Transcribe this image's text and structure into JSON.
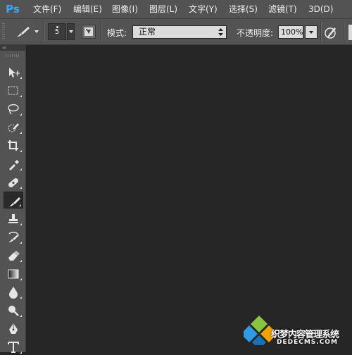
{
  "app": {
    "logo": "Ps"
  },
  "menu": {
    "items": [
      "文件(F)",
      "编辑(E)",
      "图像(I)",
      "图层(L)",
      "文字(Y)",
      "选择(S)",
      "滤镜(T)",
      "3D(D)"
    ]
  },
  "options": {
    "brush_size": "5",
    "mode_label": "模式:",
    "mode_value": "正常",
    "opacity_label": "不透明度:",
    "opacity_value": "100%"
  },
  "toolbox": {
    "collapse_label": "››",
    "tools": [
      {
        "name": "move-tool",
        "icon": "move-icon",
        "active": false
      },
      {
        "name": "rectangular-marquee-tool",
        "icon": "marquee-icon",
        "active": false
      },
      {
        "name": "lasso-tool",
        "icon": "lasso-icon",
        "active": false
      },
      {
        "name": "quick-selection-tool",
        "icon": "quick-selection-icon",
        "active": false
      },
      {
        "name": "crop-tool",
        "icon": "crop-icon",
        "active": false
      },
      {
        "name": "eyedropper-tool",
        "icon": "eyedropper-icon",
        "active": false
      },
      {
        "name": "spot-healing-brush-tool",
        "icon": "bandage-icon",
        "active": false
      },
      {
        "name": "brush-tool",
        "icon": "brush-icon",
        "active": true
      },
      {
        "name": "clone-stamp-tool",
        "icon": "stamp-icon",
        "active": false
      },
      {
        "name": "history-brush-tool",
        "icon": "history-brush-icon",
        "active": false
      },
      {
        "name": "eraser-tool",
        "icon": "eraser-icon",
        "active": false
      },
      {
        "name": "gradient-tool",
        "icon": "gradient-icon",
        "active": false
      },
      {
        "name": "blur-tool",
        "icon": "drop-icon",
        "active": false
      },
      {
        "name": "dodge-tool",
        "icon": "dodge-icon",
        "active": false
      },
      {
        "name": "pen-tool",
        "icon": "pen-icon",
        "active": false
      },
      {
        "name": "type-tool",
        "icon": "type-icon",
        "active": false
      }
    ]
  },
  "watermark": {
    "line1": "织梦内容管理系统",
    "line2": "DEDECMS.COM"
  },
  "colors": {
    "menubar": "#535353",
    "canvas": "#262626",
    "ps_logo": "#31a8ff"
  }
}
